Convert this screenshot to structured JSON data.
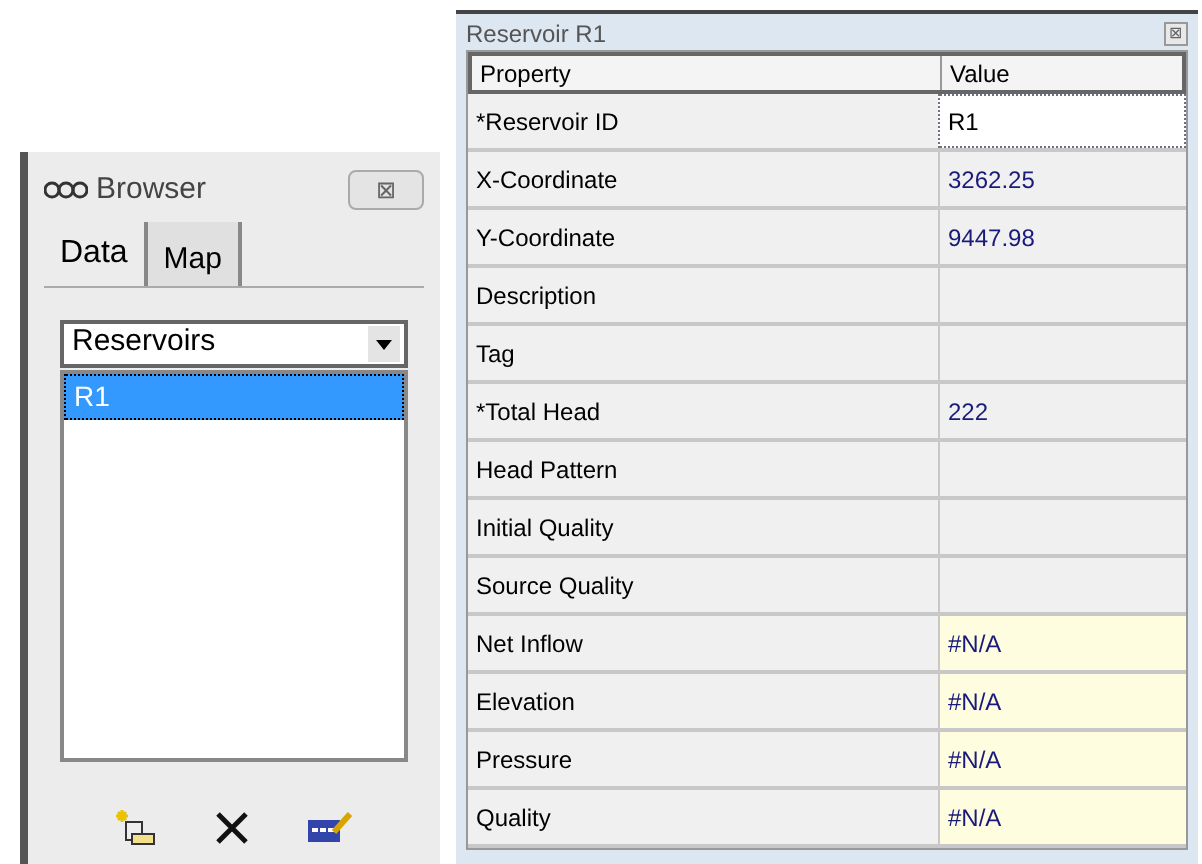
{
  "browser": {
    "title": "Browser",
    "close": "⊠",
    "tabs": [
      {
        "label": "Data",
        "selected": true
      },
      {
        "label": "Map",
        "selected": false
      }
    ],
    "dropdown": {
      "value": "Reservoirs"
    },
    "items": [
      {
        "label": "R1",
        "selected": true
      }
    ]
  },
  "editor": {
    "title": "Reservoir R1",
    "close": "⊠",
    "columns": [
      "Property",
      "Value"
    ],
    "rows": [
      {
        "property": "*Reservoir ID",
        "value": "R1",
        "kind": "editing"
      },
      {
        "property": "X-Coordinate",
        "value": "3262.25",
        "kind": "editable"
      },
      {
        "property": "Y-Coordinate",
        "value": "9447.98",
        "kind": "editable"
      },
      {
        "property": "Description",
        "kind": "editable"
      },
      {
        "property": "Tag",
        "kind": "editable"
      },
      {
        "property": "*Total Head",
        "value": "222",
        "kind": "editable"
      },
      {
        "property": "Head Pattern",
        "kind": "editable"
      },
      {
        "property": "Initial Quality",
        "kind": "editable"
      },
      {
        "property": "Source Quality",
        "kind": "editable"
      },
      {
        "property": "Net Inflow",
        "value": "#N/A",
        "kind": "computed"
      },
      {
        "property": "Elevation",
        "value": "#N/A",
        "kind": "computed"
      },
      {
        "property": "Pressure",
        "value": "#N/A",
        "kind": "computed"
      },
      {
        "property": "Quality",
        "value": "#N/A",
        "kind": "computed"
      }
    ]
  }
}
